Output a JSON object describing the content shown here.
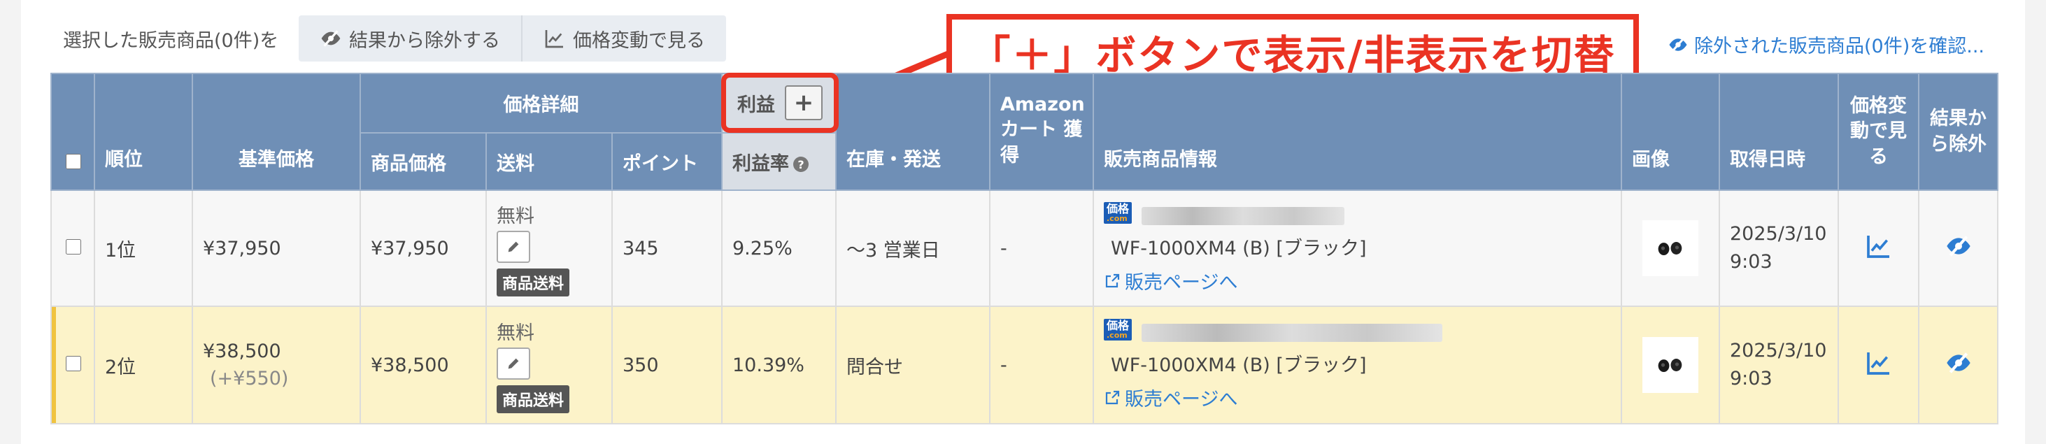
{
  "toolbar": {
    "selected_label": "選択した販売商品(0件)を",
    "exclude_label": "結果から除外する",
    "price_change_label": "価格変動で見る",
    "confirm_link": "除外された販売商品(0件)を確認..."
  },
  "callout": {
    "text": "「＋」ボタンで表示/非表示を切替"
  },
  "headers": {
    "rank": "順位",
    "base_price": "基準価格",
    "price_details": "価格詳細",
    "item_price": "商品価格",
    "shipping": "送料",
    "points": "ポイント",
    "profit": "利益",
    "profit_plus": "+",
    "profit_rate": "利益率",
    "stock": "在庫・発送",
    "amazon_cart": "Amazon カート 獲得",
    "seller_info": "販売商品情報",
    "image": "画像",
    "fetched_at": "取得日時",
    "price_change": "価格変動で見る",
    "exclude": "結果から除外"
  },
  "rows": [
    {
      "rank": "1位",
      "base_price": "¥37,950",
      "base_diff": "",
      "item_price": "¥37,950",
      "shipping": "無料",
      "shipping_badge": "商品送料",
      "points": "345",
      "profit_rate": "9.25%",
      "stock": "〜3 営業日",
      "amazon_cart": "-",
      "shop_logo": "価格",
      "shop_logo_sub": ".com",
      "item_name": "WF-1000XM4 (B) [ブラック]",
      "page_link": "販売ページへ",
      "fetched_at": "2025/3/10 9:03"
    },
    {
      "rank": "2位",
      "base_price": "¥38,500",
      "base_diff": "(+¥550)",
      "item_price": "¥38,500",
      "shipping": "無料",
      "shipping_badge": "商品送料",
      "points": "350",
      "profit_rate": "10.39%",
      "stock": "問合せ",
      "amazon_cart": "-",
      "shop_logo": "価格",
      "shop_logo_sub": ".com",
      "item_name": "WF-1000XM4 (B) [ブラック]",
      "page_link": "販売ページへ",
      "fetched_at": "2025/3/10 9:03"
    }
  ],
  "colors": {
    "header_bg": "#6f8fb6",
    "callout_red": "#ea3323",
    "link_blue": "#2d7dd2",
    "row_highlight": "#fcf3c9"
  }
}
